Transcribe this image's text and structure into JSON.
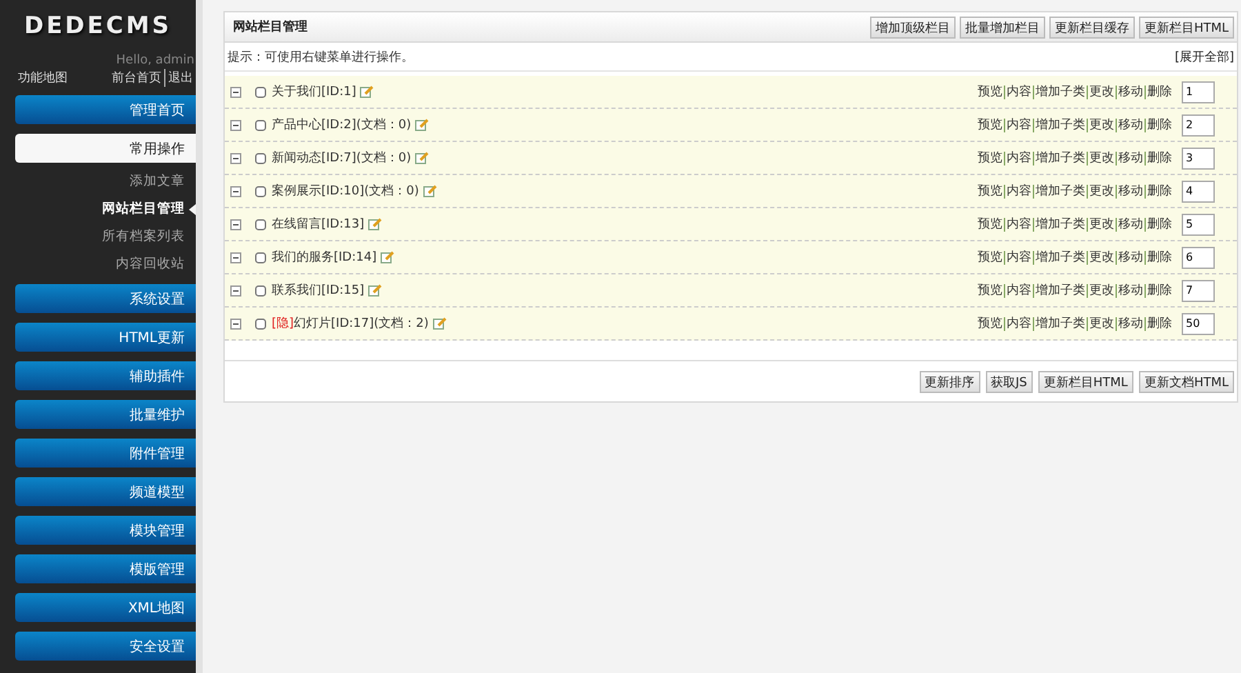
{
  "sidebar": {
    "logo": "DEDECMS",
    "greeting": "Hello, admin",
    "map_link": "功能地图",
    "links": [
      "前台首页",
      "退出"
    ],
    "menu": [
      {
        "label": "管理首页",
        "selected": false
      },
      {
        "label": "常用操作",
        "selected": true,
        "children": [
          {
            "label": "添加文章",
            "selected": false
          },
          {
            "label": "网站栏目管理",
            "selected": true
          },
          {
            "label": "所有档案列表",
            "selected": false
          },
          {
            "label": "内容回收站",
            "selected": false
          }
        ]
      },
      {
        "label": "系统设置",
        "selected": false
      },
      {
        "label": "HTML更新",
        "selected": false
      },
      {
        "label": "辅助插件",
        "selected": false
      },
      {
        "label": "批量维护",
        "selected": false
      },
      {
        "label": "附件管理",
        "selected": false
      },
      {
        "label": "频道模型",
        "selected": false
      },
      {
        "label": "模块管理",
        "selected": false
      },
      {
        "label": "模版管理",
        "selected": false
      },
      {
        "label": "XML地图",
        "selected": false
      },
      {
        "label": "安全设置",
        "selected": false
      }
    ]
  },
  "panel": {
    "title": "网站栏目管理",
    "toolbar": [
      "增加顶级栏目",
      "批量增加栏目",
      "更新栏目缓存",
      "更新栏目HTML"
    ],
    "tip": "提示：可使用右键菜单进行操作。",
    "expand_all": "[展开全部]",
    "rows": [
      {
        "label": "关于我们[ID:1]",
        "checked": false,
        "order": "1",
        "actions": [
          "预览",
          "内容",
          "增加子类",
          "更改",
          "移动",
          "删除"
        ]
      },
      {
        "label": "产品中心[ID:2](文档：0)",
        "checked": false,
        "order": "2",
        "actions": [
          "预览",
          "内容",
          "增加子类",
          "更改",
          "移动",
          "删除"
        ]
      },
      {
        "label": "新闻动态[ID:7](文档：0)",
        "checked": false,
        "order": "3",
        "actions": [
          "预览",
          "内容",
          "增加子类",
          "更改",
          "移动",
          "删除"
        ]
      },
      {
        "label": "案例展示[ID:10](文档：0)",
        "checked": false,
        "order": "4",
        "actions": [
          "预览",
          "内容",
          "增加子类",
          "更改",
          "移动",
          "删除"
        ]
      },
      {
        "label": "在线留言[ID:13]",
        "checked": false,
        "order": "5",
        "actions": [
          "预览",
          "内容",
          "增加子类",
          "更改",
          "移动",
          "删除"
        ]
      },
      {
        "label": "我们的服务[ID:14]",
        "checked": false,
        "order": "6",
        "actions": [
          "预览",
          "内容",
          "增加子类",
          "更改",
          "移动",
          "删除"
        ]
      },
      {
        "label": "联系我们[ID:15]",
        "checked": false,
        "order": "7",
        "actions": [
          "预览",
          "内容",
          "增加子类",
          "更改",
          "移动",
          "删除"
        ]
      },
      {
        "label": "幻灯片[ID:17](文档：2)",
        "tag": "[隐]",
        "checked": false,
        "order": "50",
        "actions": [
          "预览",
          "内容",
          "增加子类",
          "更改",
          "移动",
          "删除"
        ]
      }
    ],
    "footer_buttons": [
      "更新排序",
      "获取JS",
      "更新栏目HTML",
      "更新文档HTML"
    ]
  }
}
